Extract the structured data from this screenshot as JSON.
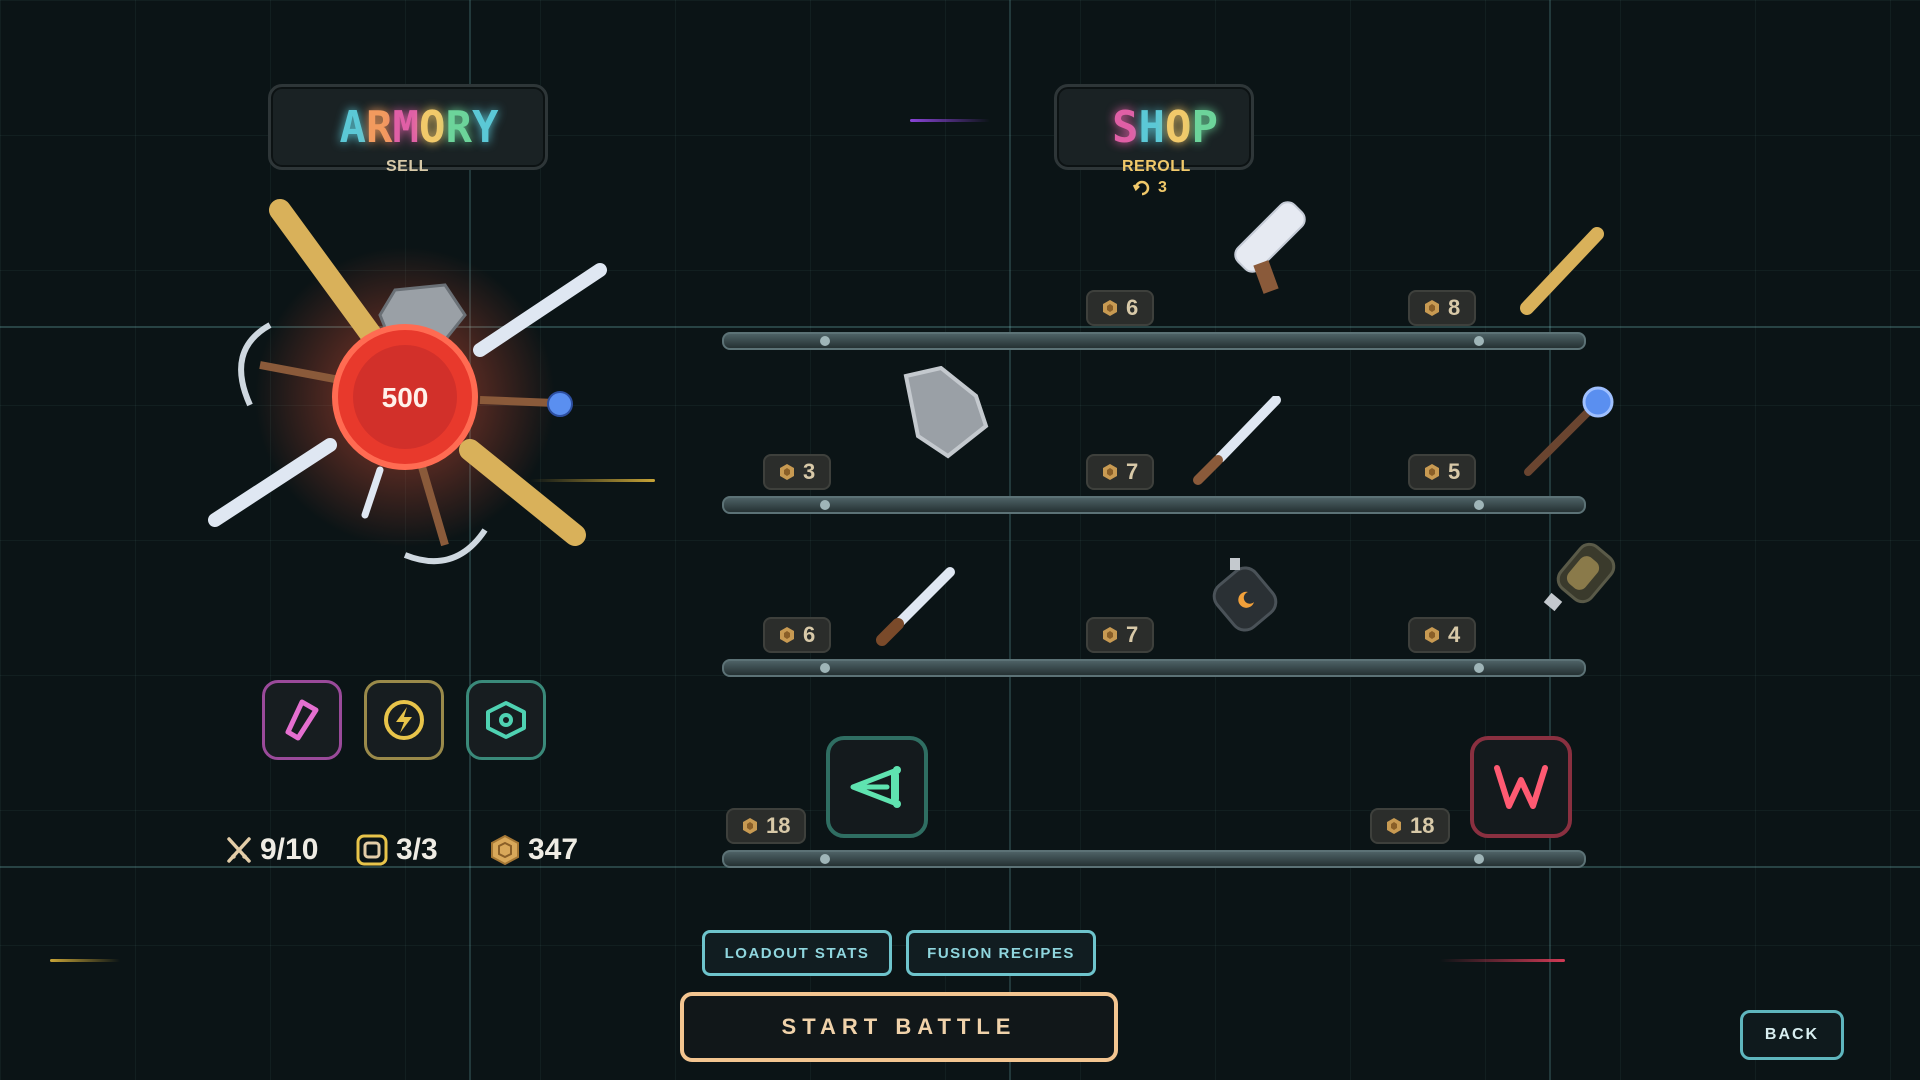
{
  "armory": {
    "title_letters": [
      {
        "ch": "A",
        "color": "#5bc8d6"
      },
      {
        "ch": "R",
        "color": "#f29a5e"
      },
      {
        "ch": "M",
        "color": "#e05fa6"
      },
      {
        "ch": "O",
        "color": "#f1c96a"
      },
      {
        "ch": "R",
        "color": "#6cd49a"
      },
      {
        "ch": "Y",
        "color": "#5bc8d6"
      }
    ],
    "sell_label": "SELL",
    "core_value": "500",
    "abilities": [
      {
        "icon": "pink-blade-icon",
        "color": "#e56fd0"
      },
      {
        "icon": "lightning-icon",
        "color": "#e8c44a"
      },
      {
        "icon": "eye-icon",
        "color": "#4fd2b2"
      }
    ],
    "stats": {
      "weapons": "9/10",
      "slots": "3/3",
      "gold": "347"
    }
  },
  "shop": {
    "title_letters": [
      {
        "ch": "S",
        "color": "#e05fa6"
      },
      {
        "ch": "H",
        "color": "#5bc8d6"
      },
      {
        "ch": "O",
        "color": "#f1c96a"
      },
      {
        "ch": "P",
        "color": "#6cd49a"
      }
    ],
    "reroll_label": "REROLL",
    "reroll_cost": "3",
    "shelves": [
      {
        "items": [
          {
            "name": "cleaver",
            "price": "6"
          },
          {
            "name": "baseball-bat",
            "price": "8"
          }
        ]
      },
      {
        "items": [
          {
            "name": "stone-shield",
            "price": "3"
          },
          {
            "name": "long-knife",
            "price": "7"
          },
          {
            "name": "magic-staff",
            "price": "5"
          }
        ]
      },
      {
        "items": [
          {
            "name": "dagger",
            "price": "6"
          },
          {
            "name": "fire-flask",
            "price": "7"
          },
          {
            "name": "elixir-bottle",
            "price": "4"
          }
        ]
      },
      {
        "items": [
          {
            "name": "slingshot-relic",
            "price": "18"
          },
          {
            "name": "fang-relic",
            "price": "18"
          }
        ]
      }
    ]
  },
  "buttons": {
    "loadout_stats": "LOADOUT STATS",
    "fusion_recipes": "FUSION RECIPES",
    "start_battle": "START BATTLE",
    "back": "BACK"
  },
  "colors": {
    "accent_teal": "#6ec4cc",
    "start_border": "#f3c590",
    "core_red": "#e8392c",
    "gold": "#d9a85a"
  }
}
